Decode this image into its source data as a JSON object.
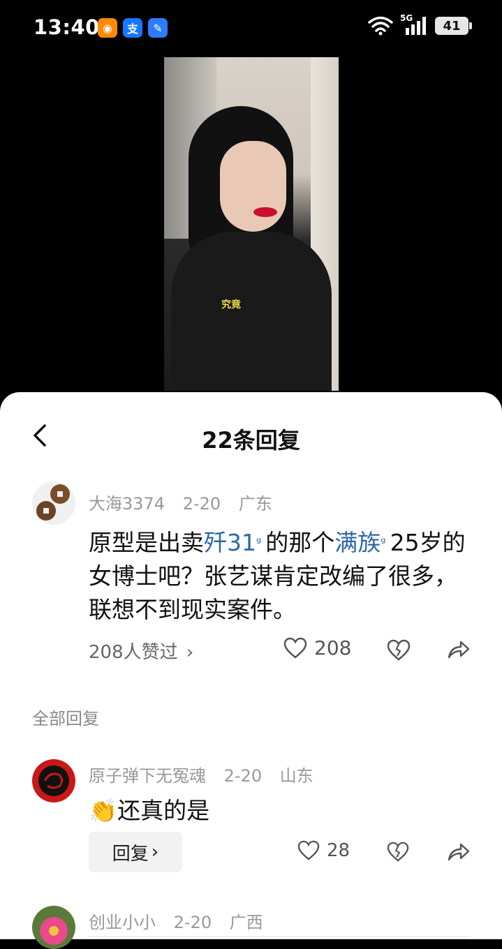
{
  "status_bar": {
    "time": "13:40",
    "network": "5G",
    "battery": "41",
    "apps": [
      {
        "name": "weibo-app-icon",
        "glyph": "◉",
        "bg": "#ff8a00"
      },
      {
        "name": "alipay-app-icon",
        "glyph": "支",
        "bg": "#1677ff"
      },
      {
        "name": "blue-app-icon",
        "glyph": "✎",
        "bg": "#2f7bff"
      }
    ]
  },
  "video": {
    "caption": "究竟"
  },
  "sheet": {
    "title": "22条回复",
    "main_comment": {
      "user": "大海3374",
      "date": "2-20",
      "location": "广东",
      "text_part1": "原型是出卖",
      "link1": "歼31",
      "text_part2": "的那个",
      "link2": "满族",
      "text_part3": "25岁的女博士吧？张艺谋肯定改编了很多，联想不到现实案件。",
      "likes_summary": "208人赞过",
      "like_count": "208"
    },
    "section_label": "全部回复",
    "replies": [
      {
        "user": "原子弹下无冤魂",
        "date": "2-20",
        "location": "山东",
        "emoji": "👏",
        "text": "还真的是",
        "reply_label": "回复",
        "like_count": "28"
      },
      {
        "user": "创业小小",
        "date": "2-20",
        "location": "广西"
      }
    ]
  },
  "colors": {
    "link": "#2c67a8",
    "meta_gray": "#999999"
  }
}
